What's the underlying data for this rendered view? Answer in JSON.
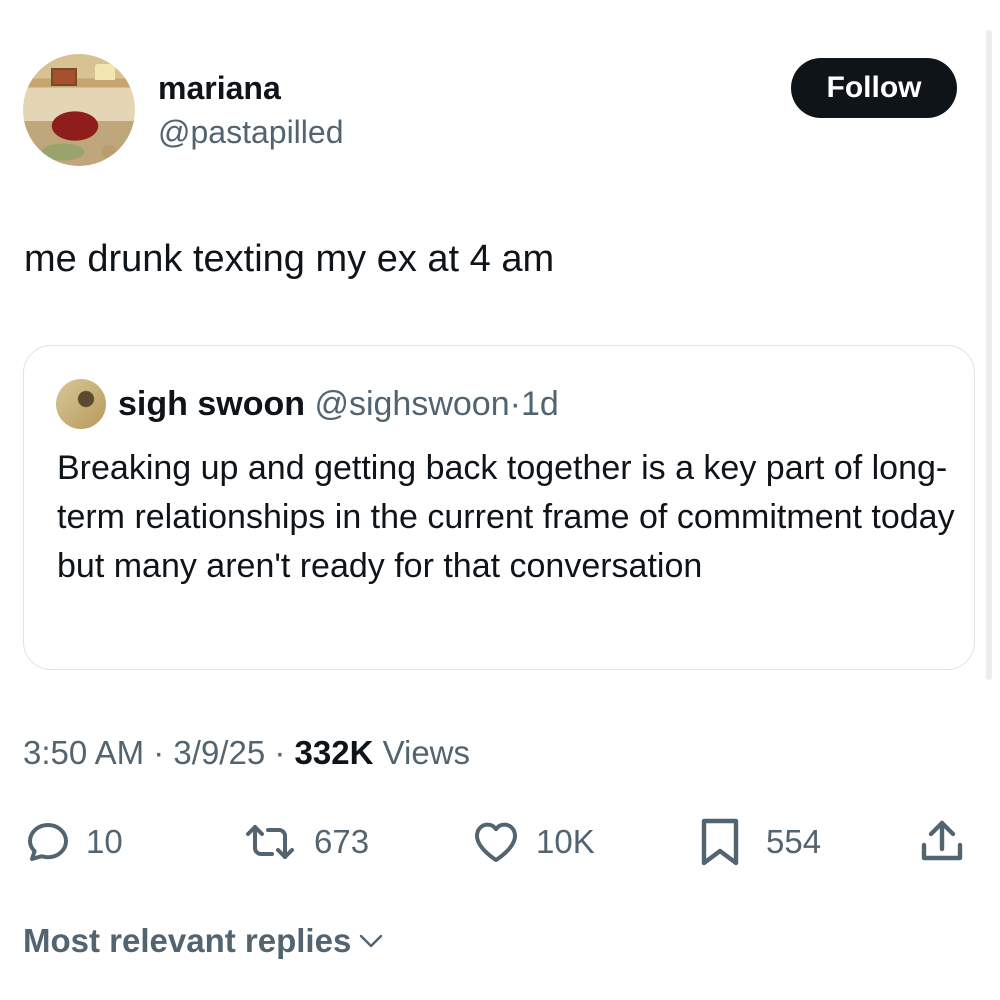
{
  "post": {
    "author": {
      "name": "mariana",
      "handle": "@pastapilled"
    },
    "follow_label": "Follow",
    "text": "me drunk texting my ex at 4 am",
    "quoted": {
      "author_name": "sigh swoon",
      "author_handle": "@sighswoon",
      "separator": "·",
      "age": "1d",
      "text": "Breaking up and getting back together is a key part of long-term relationships in the current frame of commitment today but many aren't ready for that conversation"
    },
    "meta": {
      "time": "3:50 AM",
      "separator": "·",
      "date": "3/9/25",
      "views_count": "332K",
      "views_label": "Views"
    },
    "actions": {
      "replies": "10",
      "reposts": "673",
      "likes": "10K",
      "bookmarks": "554"
    },
    "replies_sort_label": "Most relevant replies"
  },
  "icons": {
    "reply": "reply-icon",
    "repost": "repost-icon",
    "like": "heart-icon",
    "bookmark": "bookmark-icon",
    "share": "share-icon",
    "chevron": "chevron-down-icon"
  },
  "colors": {
    "text_primary": "#0f1419",
    "text_secondary": "#536471",
    "button_bg": "#0f1419",
    "button_text": "#ffffff",
    "border": "#dfe3e7"
  }
}
